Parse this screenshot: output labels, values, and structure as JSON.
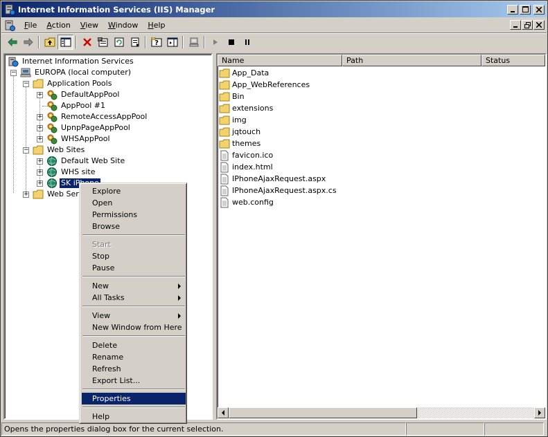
{
  "window": {
    "title": "Internet Information Services (IIS) Manager"
  },
  "menubar": {
    "items": [
      {
        "label": "File",
        "accel": "F",
        "rest": "ile"
      },
      {
        "label": "Action",
        "accel": "A",
        "rest": "ction"
      },
      {
        "label": "View",
        "accel": "V",
        "rest": "iew"
      },
      {
        "label": "Window",
        "accel": "W",
        "rest": "indow"
      },
      {
        "label": "Help",
        "accel": "H",
        "rest": "elp"
      }
    ]
  },
  "tree": {
    "root": "Internet Information Services",
    "computer": "EUROPA (local computer)",
    "app_pools": "Application Pools",
    "pools": [
      "DefaultAppPool",
      "AppPool #1",
      "RemoteAccessAppPool",
      "UpnpPageAppPool",
      "WHSAppPool"
    ],
    "web_sites": "Web Sites",
    "sites": [
      "Default Web Site",
      "WHS site",
      "SK iPhone"
    ],
    "web_service": "Web Serv"
  },
  "listview": {
    "columns": [
      "Name",
      "Path",
      "Status"
    ],
    "items": [
      {
        "name": "App_Data",
        "type": "folder"
      },
      {
        "name": "App_WebReferences",
        "type": "folder"
      },
      {
        "name": "Bin",
        "type": "folder"
      },
      {
        "name": "extensions",
        "type": "folder"
      },
      {
        "name": "img",
        "type": "folder"
      },
      {
        "name": "jqtouch",
        "type": "folder"
      },
      {
        "name": "themes",
        "type": "folder"
      },
      {
        "name": "favicon.ico",
        "type": "file"
      },
      {
        "name": "index.html",
        "type": "file"
      },
      {
        "name": "IPhoneAjaxRequest.aspx",
        "type": "file"
      },
      {
        "name": "IPhoneAjaxRequest.aspx.cs",
        "type": "file"
      },
      {
        "name": "web.config",
        "type": "file"
      }
    ]
  },
  "context_menu": {
    "explore": "Explore",
    "open": "Open",
    "permissions": "Permissions",
    "browse": "Browse",
    "start": "Start",
    "stop": "Stop",
    "pause": "Pause",
    "new": "New",
    "all_tasks": "All Tasks",
    "view": "View",
    "new_window": "New Window from Here",
    "delete": "Delete",
    "rename": "Rename",
    "refresh": "Refresh",
    "export_list": "Export List...",
    "properties": "Properties",
    "help": "Help"
  },
  "statusbar": {
    "text": "Opens the properties dialog box for the current selection."
  },
  "colors": {
    "titlebar_start": "#0a246a",
    "titlebar_end": "#a6caf0",
    "selection": "#0a246a",
    "chrome": "#d4d0c8"
  }
}
